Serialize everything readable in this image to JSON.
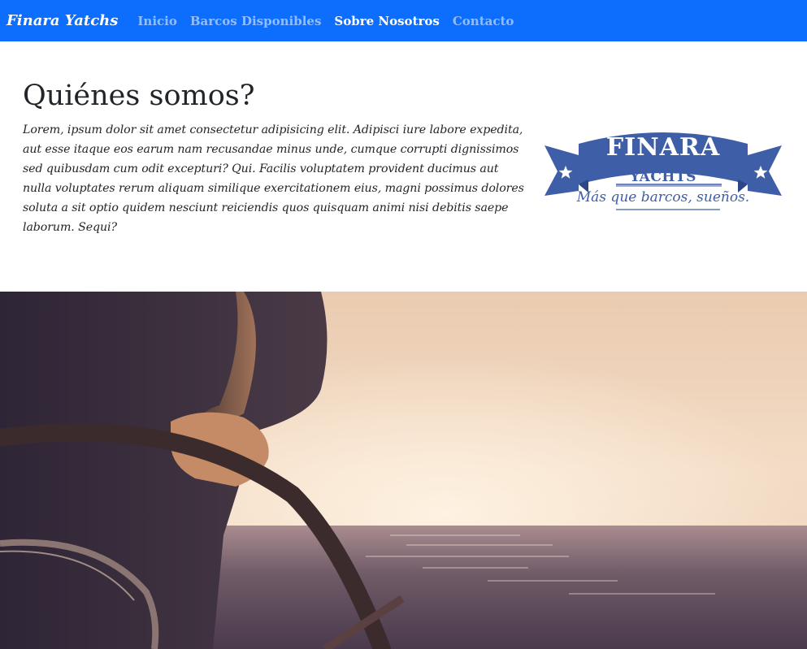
{
  "navbar": {
    "brand": "Finara Yatchs",
    "links": [
      {
        "label": "Inicio",
        "active": false
      },
      {
        "label": "Barcos Disponibles",
        "active": false
      },
      {
        "label": "Sobre Nosotros",
        "active": true
      },
      {
        "label": "Contacto",
        "active": false
      }
    ],
    "background_color": "#0d6efd"
  },
  "about": {
    "title": "Quiénes somos?",
    "body": "Lorem, ipsum dolor sit amet consectetur adipisicing elit. Adipisci iure labore expedita, aut esse itaque eos earum nam recusandae minus unde, cumque corrupti dignissimos sed quibusdam cum odit excepturi? Qui. Facilis voluptatem provident ducimus aut nulla voluptates rerum aliquam similique exercitationem eius, magni possimus dolores soluta a sit optio quidem nesciunt reiciendis quos quisquam animi nisi debitis saepe laborum. Sequi?"
  },
  "logo": {
    "name": "FINARA",
    "subtitle": "YACHTS",
    "tagline": "Más que barcos, sueños.",
    "color": "#3f5ea8"
  },
  "hero": {
    "image": "person-steering-boat-wheel-at-sunset"
  }
}
